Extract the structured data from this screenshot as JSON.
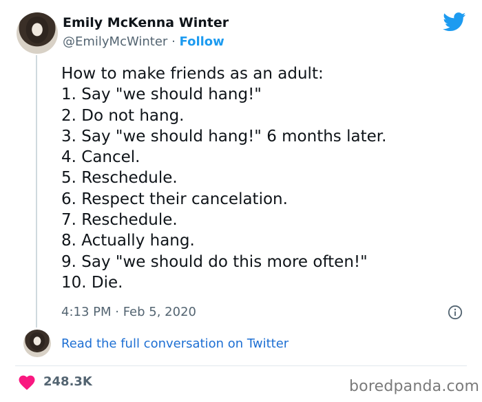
{
  "tweet": {
    "author_name": "Emily McKenna Winter",
    "handle": "@EmilyMcWinter",
    "separator": " · ",
    "follow_label": "Follow",
    "lines": [
      "How to make friends as an adult:",
      "1. Say \"we should hang!\"",
      "2. Do not hang.",
      "3. Say \"we should hang!\" 6 months later.",
      "4. Cancel.",
      "5. Reschedule.",
      "6. Respect their cancelation.",
      "7. Reschedule.",
      "8. Actually hang.",
      "9. Say \"we should do this more often!\"",
      "10. Die."
    ],
    "timestamp": "4:13 PM · Feb 5, 2020",
    "read_conversation": "Read the full conversation on Twitter",
    "likes": "248.3K"
  },
  "icons": {
    "brand": "twitter-bird-icon",
    "info": "info-icon",
    "like": "heart-icon"
  },
  "colors": {
    "twitter_blue": "#1d9bf0",
    "link_blue": "#1d6fd3",
    "heart_pink": "#f91880",
    "muted": "#536471"
  },
  "watermark": "boredpanda.com"
}
